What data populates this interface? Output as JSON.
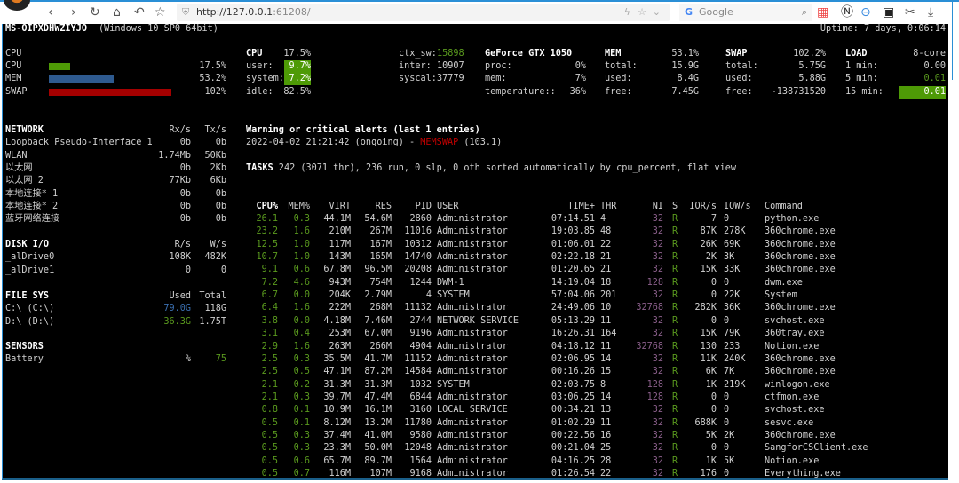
{
  "browser": {
    "url_host": "http://127.0.0.1",
    "url_port": ":61208/",
    "search_placeholder": "Google"
  },
  "header": {
    "hostname": "MS-OIPXDHWZIYJO",
    "os": "(Windows 10 SP0 64bit)",
    "uptime": "Uptime: 7 days, 0:06:14"
  },
  "quicklook": {
    "title": "CPU",
    "rows": [
      {
        "label": "CPU",
        "value": "17.5%",
        "percent": 17.5,
        "color": "#4e9a06"
      },
      {
        "label": "MEM",
        "value": "53.2%",
        "percent": 53.2,
        "color": "#2e5a8f"
      },
      {
        "label": "SWAP",
        "value": "102%",
        "percent": 102,
        "color": "#a40000"
      }
    ]
  },
  "cpu": {
    "title": "CPU",
    "total": "17.5%",
    "user_label": "user:",
    "user": "9.7%",
    "system_label": "system:",
    "system": "7.2%",
    "idle_label": "idle:",
    "idle": "82.5%",
    "ctx_sw_label": "ctx_sw:",
    "ctx_sw": "15898",
    "inter_label": "inter:",
    "inter": "10907",
    "syscal_label": "syscal:",
    "syscal": "37779"
  },
  "gpu": {
    "title": "GeForce GTX 1050",
    "proc_label": "proc:",
    "proc": "0%",
    "mem_label": "mem:",
    "mem": "7%",
    "temp_label": "temperature::",
    "temp": "36%"
  },
  "mem": {
    "title": "MEM",
    "percent": "53.1%",
    "total_label": "total:",
    "total": "15.9G",
    "used_label": "used:",
    "used": "8.4G",
    "free_label": "free:",
    "free": "7.45G"
  },
  "swap": {
    "title": "SWAP",
    "percent": "102.2%",
    "total_label": "total:",
    "total": "5.75G",
    "used_label": "used:",
    "used": "5.88G",
    "free_label": "free:",
    "free": "-138731520"
  },
  "load": {
    "title": "LOAD",
    "cores": "8-core",
    "m1_label": "1 min:",
    "m1": "0.00",
    "m5_label": "5 min:",
    "m5": "0.01",
    "m15_label": "15 min:",
    "m15": "0.01"
  },
  "network": {
    "title": "NETWORK",
    "rx": "Rx/s",
    "tx": "Tx/s",
    "rows": [
      {
        "name": "Loopback Pseudo-Interface 1",
        "rx": "0b",
        "tx": "0b"
      },
      {
        "name": "WLAN",
        "rx": "1.74Mb",
        "tx": "50Kb"
      },
      {
        "name": "以太网",
        "rx": "0b",
        "tx": "2Kb"
      },
      {
        "name": "以太网 2",
        "rx": "77Kb",
        "tx": "6Kb"
      },
      {
        "name": "本地连接* 1",
        "rx": "0b",
        "tx": "0b"
      },
      {
        "name": "本地连接* 2",
        "rx": "0b",
        "tx": "0b"
      },
      {
        "name": "蓝牙网络连接",
        "rx": "0b",
        "tx": "0b"
      }
    ]
  },
  "disk": {
    "title": "DISK I/O",
    "r": "R/s",
    "w": "W/s",
    "rows": [
      {
        "name": "_alDrive0",
        "r": "108K",
        "w": "482K"
      },
      {
        "name": "_alDrive1",
        "r": "0",
        "w": "0"
      }
    ]
  },
  "fs": {
    "title": "FILE SYS",
    "used": "Used",
    "total": "Total",
    "rows": [
      {
        "name": "C:\\ (C:\\)",
        "used": "79.0G",
        "total": "118G",
        "color": "#3a6fb0"
      },
      {
        "name": "D:\\ (D:\\)",
        "used": "36.3G",
        "total": "1.75T",
        "color": "#5a9a1e"
      }
    ]
  },
  "sensors": {
    "title": "SENSORS",
    "rows": [
      {
        "name": "Battery",
        "unit": "%",
        "value": "75"
      }
    ]
  },
  "alerts": {
    "title": "Warning or critical alerts (last 1 entries)",
    "time": "2022-04-02 21:21:42 (ongoing) - ",
    "type": "MEMSWAP",
    "value": " (103.1)"
  },
  "tasks": {
    "label": "TASKS",
    "summary": " 242 (3071 thr), 236 run, 0 slp, 0 oth sorted automatically by cpu_percent, flat view"
  },
  "processes": {
    "columns": {
      "cpu": "CPU%",
      "mem": "MEM%",
      "virt": "VIRT",
      "res": "RES",
      "pid": "PID",
      "user": "USER",
      "time": "TIME+",
      "thr": "THR",
      "ni": "NI",
      "s": "S",
      "ior": "IOR/s",
      "iow": "IOW/s",
      "cmd": "Command"
    },
    "rows": [
      {
        "cpu": "26.1",
        "mem": "0.3",
        "virt": "44.1M",
        "res": "54.6M",
        "pid": "2860",
        "user": "Administrator",
        "time": "07:14.51",
        "thr": "4",
        "ni": "32",
        "s": "R",
        "ior": "7",
        "iow": "0",
        "cmd": "python.exe"
      },
      {
        "cpu": "23.2",
        "mem": "1.6",
        "virt": "210M",
        "res": "267M",
        "pid": "11016",
        "user": "Administrator",
        "time": "19:03.85",
        "thr": "48",
        "ni": "32",
        "s": "R",
        "ior": "87K",
        "iow": "278K",
        "cmd": "360chrome.exe"
      },
      {
        "cpu": "12.5",
        "mem": "1.0",
        "virt": "117M",
        "res": "167M",
        "pid": "10312",
        "user": "Administrator",
        "time": "01:06.01",
        "thr": "22",
        "ni": "32",
        "s": "R",
        "ior": "26K",
        "iow": "69K",
        "cmd": "360chrome.exe"
      },
      {
        "cpu": "10.7",
        "mem": "1.0",
        "virt": "143M",
        "res": "165M",
        "pid": "14740",
        "user": "Administrator",
        "time": "02:22.18",
        "thr": "21",
        "ni": "32",
        "s": "R",
        "ior": "2K",
        "iow": "3K",
        "cmd": "360chrome.exe"
      },
      {
        "cpu": "9.1",
        "mem": "0.6",
        "virt": "67.8M",
        "res": "96.5M",
        "pid": "20208",
        "user": "Administrator",
        "time": "01:20.65",
        "thr": "21",
        "ni": "32",
        "s": "R",
        "ior": "15K",
        "iow": "33K",
        "cmd": "360chrome.exe"
      },
      {
        "cpu": "7.2",
        "mem": "4.6",
        "virt": "943M",
        "res": "754M",
        "pid": "1244",
        "user": "DWM-1",
        "time": "14:19.04",
        "thr": "18",
        "ni": "128",
        "s": "R",
        "ior": "0",
        "iow": "0",
        "cmd": "dwm.exe"
      },
      {
        "cpu": "6.7",
        "mem": "0.0",
        "virt": "204K",
        "res": "2.79M",
        "pid": "4",
        "user": "SYSTEM",
        "time": "57:04.06",
        "thr": "201",
        "ni": "32",
        "s": "R",
        "ior": "0",
        "iow": "22K",
        "cmd": "System"
      },
      {
        "cpu": "6.4",
        "mem": "1.6",
        "virt": "222M",
        "res": "268M",
        "pid": "11132",
        "user": "Administrator",
        "time": "24:49.06",
        "thr": "10",
        "ni": "32768",
        "s": "R",
        "ior": "282K",
        "iow": "36K",
        "cmd": "360chrome.exe"
      },
      {
        "cpu": "3.8",
        "mem": "0.0",
        "virt": "4.18M",
        "res": "7.46M",
        "pid": "2744",
        "user": "NETWORK SERVICE",
        "time": "05:13.29",
        "thr": "11",
        "ni": "32",
        "s": "R",
        "ior": "0",
        "iow": "0",
        "cmd": "svchost.exe"
      },
      {
        "cpu": "3.1",
        "mem": "0.4",
        "virt": "253M",
        "res": "67.0M",
        "pid": "9196",
        "user": "Administrator",
        "time": "16:26.31",
        "thr": "164",
        "ni": "32",
        "s": "R",
        "ior": "15K",
        "iow": "79K",
        "cmd": "360tray.exe"
      },
      {
        "cpu": "2.9",
        "mem": "1.6",
        "virt": "263M",
        "res": "266M",
        "pid": "4904",
        "user": "Administrator",
        "time": "04:18.12",
        "thr": "11",
        "ni": "32768",
        "s": "R",
        "ior": "130",
        "iow": "233",
        "cmd": "Notion.exe"
      },
      {
        "cpu": "2.5",
        "mem": "0.3",
        "virt": "35.5M",
        "res": "41.7M",
        "pid": "11152",
        "user": "Administrator",
        "time": "02:06.95",
        "thr": "14",
        "ni": "32",
        "s": "R",
        "ior": "11K",
        "iow": "240K",
        "cmd": "360chrome.exe"
      },
      {
        "cpu": "2.5",
        "mem": "0.5",
        "virt": "47.1M",
        "res": "87.2M",
        "pid": "14584",
        "user": "Administrator",
        "time": "00:16.26",
        "thr": "15",
        "ni": "32",
        "s": "R",
        "ior": "6K",
        "iow": "7K",
        "cmd": "360chrome.exe"
      },
      {
        "cpu": "2.1",
        "mem": "0.2",
        "virt": "31.3M",
        "res": "31.3M",
        "pid": "1032",
        "user": "SYSTEM",
        "time": "02:03.75",
        "thr": "8",
        "ni": "128",
        "s": "R",
        "ior": "1K",
        "iow": "219K",
        "cmd": "winlogon.exe"
      },
      {
        "cpu": "2.1",
        "mem": "0.3",
        "virt": "39.7M",
        "res": "47.4M",
        "pid": "6844",
        "user": "Administrator",
        "time": "03:06.25",
        "thr": "14",
        "ni": "128",
        "s": "R",
        "ior": "0",
        "iow": "0",
        "cmd": "ctfmon.exe"
      },
      {
        "cpu": "0.8",
        "mem": "0.1",
        "virt": "10.9M",
        "res": "16.1M",
        "pid": "3160",
        "user": "LOCAL SERVICE",
        "time": "00:34.21",
        "thr": "13",
        "ni": "32",
        "s": "R",
        "ior": "0",
        "iow": "0",
        "cmd": "svchost.exe"
      },
      {
        "cpu": "0.5",
        "mem": "0.1",
        "virt": "8.12M",
        "res": "13.2M",
        "pid": "11780",
        "user": "Administrator",
        "time": "01:02.29",
        "thr": "11",
        "ni": "32",
        "s": "R",
        "ior": "688K",
        "iow": "0",
        "cmd": "sesvc.exe"
      },
      {
        "cpu": "0.5",
        "mem": "0.3",
        "virt": "37.4M",
        "res": "41.0M",
        "pid": "9580",
        "user": "Administrator",
        "time": "00:22.56",
        "thr": "16",
        "ni": "32",
        "s": "R",
        "ior": "5K",
        "iow": "2K",
        "cmd": "360chrome.exe"
      },
      {
        "cpu": "0.5",
        "mem": "0.3",
        "virt": "23.3M",
        "res": "50.0M",
        "pid": "12048",
        "user": "Administrator",
        "time": "00:21.04",
        "thr": "25",
        "ni": "32",
        "s": "R",
        "ior": "0",
        "iow": "0",
        "cmd": "SangforCSClient.exe"
      },
      {
        "cpu": "0.5",
        "mem": "0.6",
        "virt": "65.7M",
        "res": "89.7M",
        "pid": "1564",
        "user": "Administrator",
        "time": "04:16.25",
        "thr": "28",
        "ni": "32",
        "s": "R",
        "ior": "1K",
        "iow": "5K",
        "cmd": "Notion.exe"
      },
      {
        "cpu": "0.5",
        "mem": "0.7",
        "virt": "116M",
        "res": "107M",
        "pid": "9168",
        "user": "Administrator",
        "time": "01:26.54",
        "thr": "22",
        "ni": "32",
        "s": "R",
        "ior": "176",
        "iow": "0",
        "cmd": "Everything.exe"
      }
    ]
  }
}
